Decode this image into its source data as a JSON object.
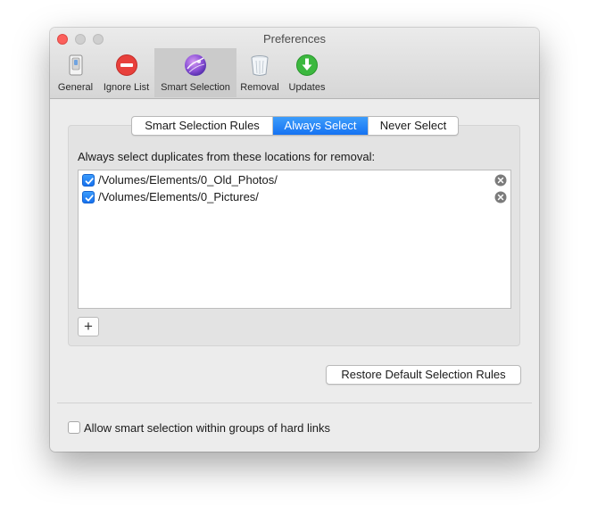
{
  "window": {
    "title": "Preferences"
  },
  "toolbar": {
    "items": [
      {
        "label": "General",
        "icon": "general-switch-icon"
      },
      {
        "label": "Ignore List",
        "icon": "no-entry-icon"
      },
      {
        "label": "Smart Selection",
        "icon": "smart-selection-globe-icon",
        "active": true
      },
      {
        "label": "Removal",
        "icon": "trash-bin-icon"
      },
      {
        "label": "Updates",
        "icon": "download-arrow-icon"
      }
    ]
  },
  "tabs": {
    "items": [
      {
        "label": "Smart Selection Rules"
      },
      {
        "label": "Always Select",
        "selected": true
      },
      {
        "label": "Never Select"
      }
    ]
  },
  "content": {
    "description": "Always select duplicates from these locations for removal:",
    "locations": [
      {
        "path": "/Volumes/Elements/0_Old_Photos/",
        "checked": true
      },
      {
        "path": "/Volumes/Elements/0_Pictures/",
        "checked": true
      }
    ],
    "add_label": "+",
    "restore_label": "Restore Default Selection Rules"
  },
  "footer": {
    "hard_links_label": "Allow smart selection within groups of hard links",
    "hard_links_checked": false
  },
  "colors": {
    "accent": "#1a78f5",
    "close_button": "#fc605c",
    "ignore_icon": "#e8403b",
    "updates_icon": "#3cb83f",
    "smart_selection_icon": "#8a4fd6"
  }
}
